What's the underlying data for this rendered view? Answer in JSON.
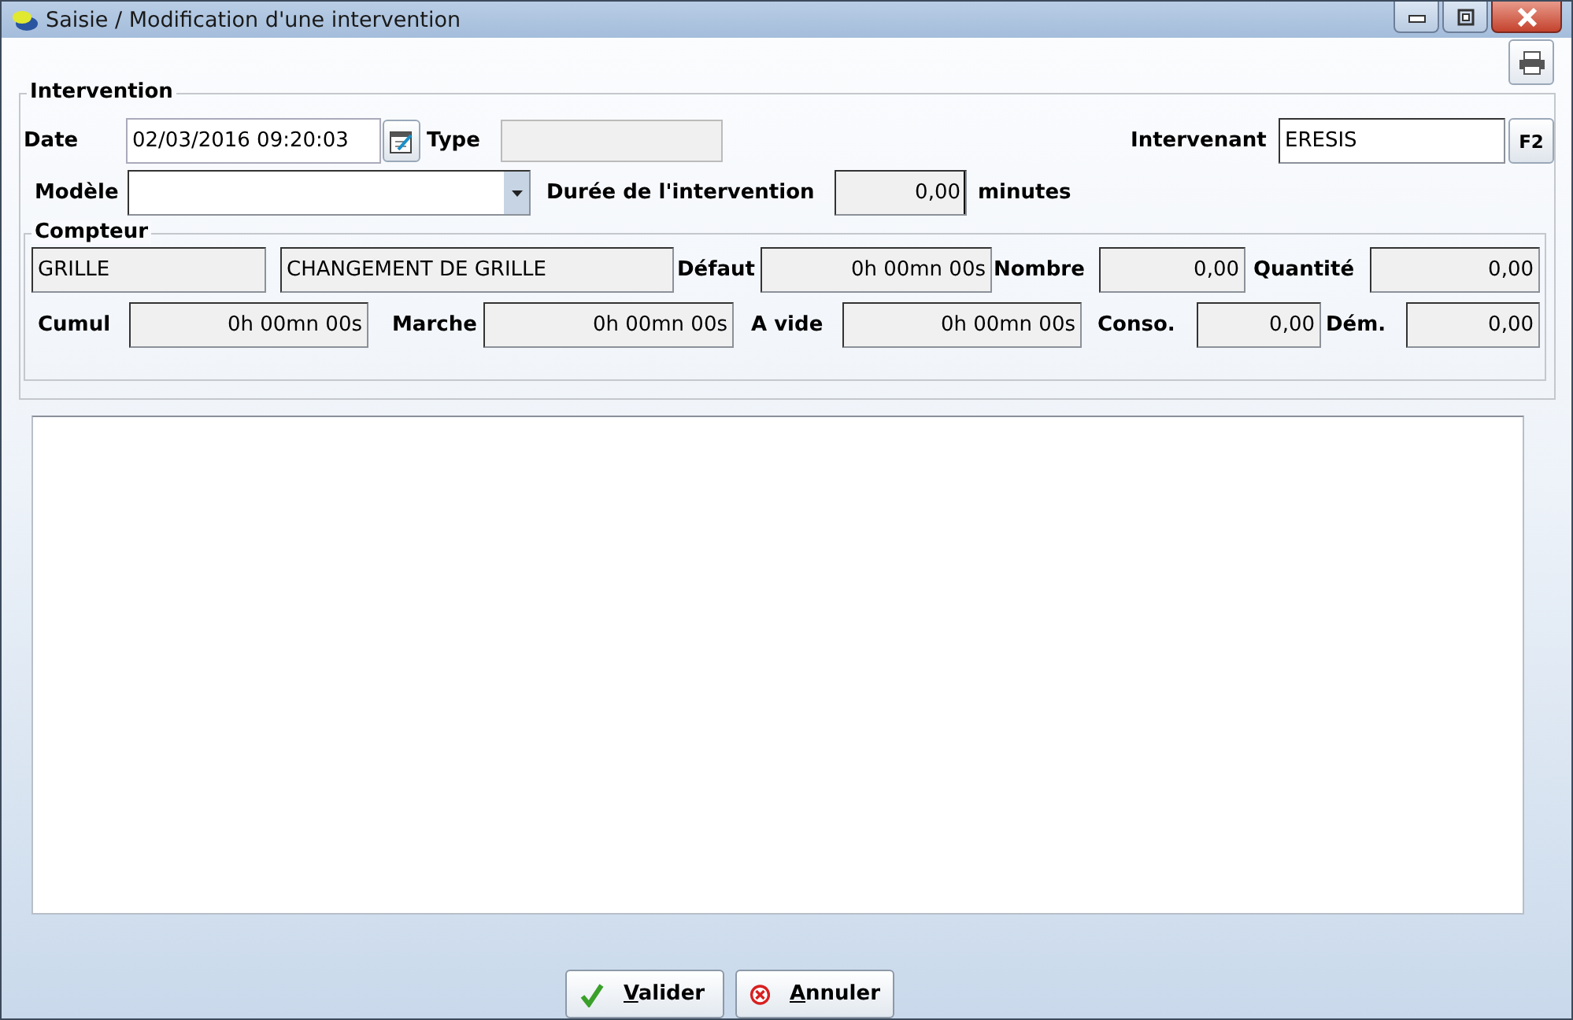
{
  "window": {
    "title": "Saisie / Modification d'une intervention"
  },
  "intervention": {
    "legend": "Intervention",
    "date": {
      "label": "Date",
      "value": "02/03/2016 09:20:03",
      "readonly": false
    },
    "type": {
      "label": "Type",
      "readonly": true
    },
    "intervenant": {
      "label": "Intervenant",
      "value": "ERESIS",
      "readonly": false,
      "key_button": "F2"
    },
    "modele": {
      "label": "Modèle",
      "readonly": false
    },
    "duree": {
      "label": "Durée de l'intervention",
      "value": "0,00",
      "unit": "minutes",
      "readonly": true,
      "focused": true
    }
  },
  "compteur": {
    "legend": "Compteur",
    "rows": [
      [
        {
          "value": "GRILLE",
          "readonly": true
        },
        {
          "value": "CHANGEMENT DE GRILLE",
          "readonly": true
        },
        {
          "label": "Défaut",
          "value": "0h 00mn 00s",
          "readonly": true
        },
        {
          "label": "Nombre",
          "value": "0,00",
          "readonly": true
        },
        {
          "label": "Quantité",
          "value": "0,00",
          "readonly": true
        }
      ],
      [
        {
          "label": "Cumul",
          "value": "0h 00mn 00s",
          "readonly": true
        },
        {
          "label": "Marche",
          "value": "0h 00mn 00s",
          "readonly": true
        },
        {
          "label": "A vide",
          "value": "0h 00mn 00s",
          "readonly": true
        },
        {
          "label": "Conso.",
          "value": "0,00",
          "readonly": true
        },
        {
          "label": "Dém.",
          "value": "0,00",
          "readonly": true
        }
      ]
    ]
  },
  "buttons": [
    {
      "kind": "ok",
      "label": "Valider"
    },
    {
      "kind": "cancel",
      "label": "Annuler"
    }
  ]
}
